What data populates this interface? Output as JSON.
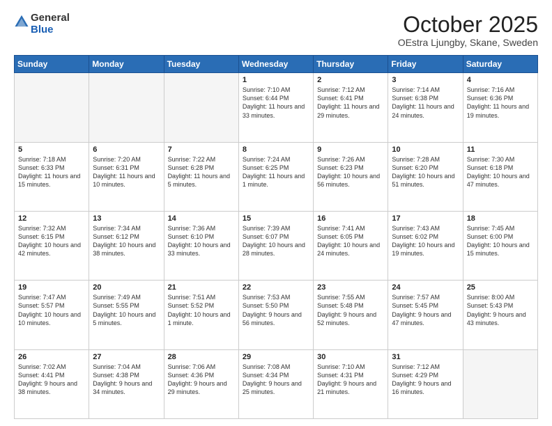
{
  "header": {
    "logo_general": "General",
    "logo_blue": "Blue",
    "month_year": "October 2025",
    "location": "OEstra Ljungby, Skane, Sweden"
  },
  "days_of_week": [
    "Sunday",
    "Monday",
    "Tuesday",
    "Wednesday",
    "Thursday",
    "Friday",
    "Saturday"
  ],
  "weeks": [
    [
      {
        "day": "",
        "info": ""
      },
      {
        "day": "",
        "info": ""
      },
      {
        "day": "",
        "info": ""
      },
      {
        "day": "1",
        "info": "Sunrise: 7:10 AM\nSunset: 6:44 PM\nDaylight: 11 hours\nand 33 minutes."
      },
      {
        "day": "2",
        "info": "Sunrise: 7:12 AM\nSunset: 6:41 PM\nDaylight: 11 hours\nand 29 minutes."
      },
      {
        "day": "3",
        "info": "Sunrise: 7:14 AM\nSunset: 6:38 PM\nDaylight: 11 hours\nand 24 minutes."
      },
      {
        "day": "4",
        "info": "Sunrise: 7:16 AM\nSunset: 6:36 PM\nDaylight: 11 hours\nand 19 minutes."
      }
    ],
    [
      {
        "day": "5",
        "info": "Sunrise: 7:18 AM\nSunset: 6:33 PM\nDaylight: 11 hours\nand 15 minutes."
      },
      {
        "day": "6",
        "info": "Sunrise: 7:20 AM\nSunset: 6:31 PM\nDaylight: 11 hours\nand 10 minutes."
      },
      {
        "day": "7",
        "info": "Sunrise: 7:22 AM\nSunset: 6:28 PM\nDaylight: 11 hours\nand 5 minutes."
      },
      {
        "day": "8",
        "info": "Sunrise: 7:24 AM\nSunset: 6:25 PM\nDaylight: 11 hours\nand 1 minute."
      },
      {
        "day": "9",
        "info": "Sunrise: 7:26 AM\nSunset: 6:23 PM\nDaylight: 10 hours\nand 56 minutes."
      },
      {
        "day": "10",
        "info": "Sunrise: 7:28 AM\nSunset: 6:20 PM\nDaylight: 10 hours\nand 51 minutes."
      },
      {
        "day": "11",
        "info": "Sunrise: 7:30 AM\nSunset: 6:18 PM\nDaylight: 10 hours\nand 47 minutes."
      }
    ],
    [
      {
        "day": "12",
        "info": "Sunrise: 7:32 AM\nSunset: 6:15 PM\nDaylight: 10 hours\nand 42 minutes."
      },
      {
        "day": "13",
        "info": "Sunrise: 7:34 AM\nSunset: 6:12 PM\nDaylight: 10 hours\nand 38 minutes."
      },
      {
        "day": "14",
        "info": "Sunrise: 7:36 AM\nSunset: 6:10 PM\nDaylight: 10 hours\nand 33 minutes."
      },
      {
        "day": "15",
        "info": "Sunrise: 7:39 AM\nSunset: 6:07 PM\nDaylight: 10 hours\nand 28 minutes."
      },
      {
        "day": "16",
        "info": "Sunrise: 7:41 AM\nSunset: 6:05 PM\nDaylight: 10 hours\nand 24 minutes."
      },
      {
        "day": "17",
        "info": "Sunrise: 7:43 AM\nSunset: 6:02 PM\nDaylight: 10 hours\nand 19 minutes."
      },
      {
        "day": "18",
        "info": "Sunrise: 7:45 AM\nSunset: 6:00 PM\nDaylight: 10 hours\nand 15 minutes."
      }
    ],
    [
      {
        "day": "19",
        "info": "Sunrise: 7:47 AM\nSunset: 5:57 PM\nDaylight: 10 hours\nand 10 minutes."
      },
      {
        "day": "20",
        "info": "Sunrise: 7:49 AM\nSunset: 5:55 PM\nDaylight: 10 hours\nand 5 minutes."
      },
      {
        "day": "21",
        "info": "Sunrise: 7:51 AM\nSunset: 5:52 PM\nDaylight: 10 hours\nand 1 minute."
      },
      {
        "day": "22",
        "info": "Sunrise: 7:53 AM\nSunset: 5:50 PM\nDaylight: 9 hours\nand 56 minutes."
      },
      {
        "day": "23",
        "info": "Sunrise: 7:55 AM\nSunset: 5:48 PM\nDaylight: 9 hours\nand 52 minutes."
      },
      {
        "day": "24",
        "info": "Sunrise: 7:57 AM\nSunset: 5:45 PM\nDaylight: 9 hours\nand 47 minutes."
      },
      {
        "day": "25",
        "info": "Sunrise: 8:00 AM\nSunset: 5:43 PM\nDaylight: 9 hours\nand 43 minutes."
      }
    ],
    [
      {
        "day": "26",
        "info": "Sunrise: 7:02 AM\nSunset: 4:41 PM\nDaylight: 9 hours\nand 38 minutes."
      },
      {
        "day": "27",
        "info": "Sunrise: 7:04 AM\nSunset: 4:38 PM\nDaylight: 9 hours\nand 34 minutes."
      },
      {
        "day": "28",
        "info": "Sunrise: 7:06 AM\nSunset: 4:36 PM\nDaylight: 9 hours\nand 29 minutes."
      },
      {
        "day": "29",
        "info": "Sunrise: 7:08 AM\nSunset: 4:34 PM\nDaylight: 9 hours\nand 25 minutes."
      },
      {
        "day": "30",
        "info": "Sunrise: 7:10 AM\nSunset: 4:31 PM\nDaylight: 9 hours\nand 21 minutes."
      },
      {
        "day": "31",
        "info": "Sunrise: 7:12 AM\nSunset: 4:29 PM\nDaylight: 9 hours\nand 16 minutes."
      },
      {
        "day": "",
        "info": ""
      }
    ]
  ]
}
